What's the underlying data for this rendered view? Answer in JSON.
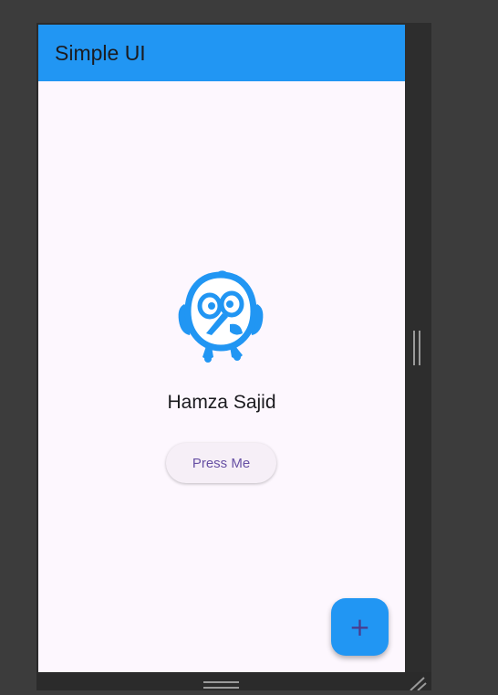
{
  "app_bar": {
    "title": "Simple UI",
    "color": "#2196f3"
  },
  "profile": {
    "logo_icon": "bird-logo-icon",
    "name": "Hamza Sajid"
  },
  "actions": {
    "press_button_label": "Press Me",
    "fab_label": "+",
    "fab_icon": "add-icon"
  },
  "colors": {
    "screen_background": "#fdf7fe",
    "accent": "#2196f3",
    "button_text": "#6750a4"
  }
}
